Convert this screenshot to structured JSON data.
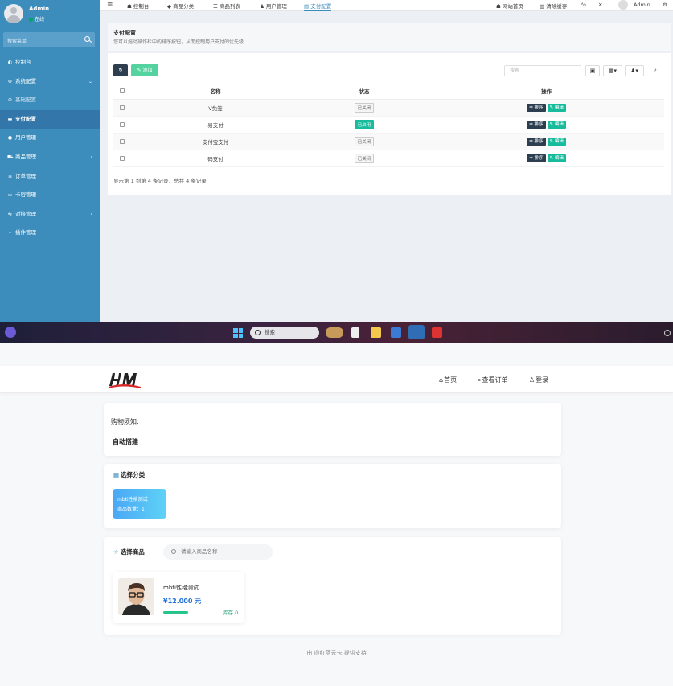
{
  "admin": {
    "user": {
      "name": "Admin",
      "status": "在线"
    },
    "sidebar": {
      "search_placeholder": "搜索菜单",
      "items": [
        {
          "label": "控制台",
          "icon": "dashboard-icon"
        },
        {
          "label": "系统配置",
          "icon": "gear-icon",
          "arrow": "⌄"
        },
        {
          "label": "基础配置",
          "icon": "gear-icon"
        },
        {
          "label": "支付配置",
          "icon": "card-icon",
          "active": true
        },
        {
          "label": "用户管理",
          "icon": "user-icon"
        },
        {
          "label": "商品管理",
          "icon": "cart-icon",
          "arrow": "‹"
        },
        {
          "label": "订单管理",
          "icon": "list-icon"
        },
        {
          "label": "卡密管理",
          "icon": "card-icon"
        },
        {
          "label": "对接管理",
          "icon": "link-icon",
          "arrow": "‹"
        },
        {
          "label": "插件管理",
          "icon": "plugin-icon"
        }
      ]
    },
    "topnav": {
      "tabs": [
        "控制台",
        "商品分类",
        "商品列表",
        "用户管理",
        "支付配置"
      ],
      "right": [
        "网站首页",
        "清除缓存"
      ],
      "user": "Admin"
    },
    "header": {
      "title": "支付配置",
      "desc": "您可以拖动操作栏中的排序按钮，从而控制用户支付的优先级"
    },
    "toolbar": {
      "add_label": "添加",
      "search_placeholder": "搜索"
    },
    "table": {
      "columns": [
        "名称",
        "状态",
        "操作"
      ],
      "rows": [
        {
          "name": "V免签",
          "status": "已关闭",
          "on": false,
          "op1": "排序",
          "op2": "编辑"
        },
        {
          "name": "易支付",
          "status": "已启用",
          "on": true,
          "op1": "排序",
          "op2": "编辑"
        },
        {
          "name": "支付宝支付",
          "status": "已关闭",
          "on": false,
          "op1": "排序",
          "op2": "编辑"
        },
        {
          "name": "码支付",
          "status": "已关闭",
          "on": false,
          "op1": "排序",
          "op2": "编辑"
        }
      ]
    },
    "pager": "显示第 1 到第 4 条记录，总共 4 条记录"
  },
  "taskbar": {
    "search": "搜索"
  },
  "shop": {
    "nav": [
      "首页",
      "查看订单",
      "登录"
    ],
    "notice": {
      "title": "购物须知:",
      "content": "自动搭建"
    },
    "category": {
      "title": "选择分类",
      "items": [
        {
          "name": "mbti性格测试",
          "count": "商品数量：1"
        }
      ]
    },
    "products": {
      "title": "选择商品",
      "search_placeholder": "请输入商品名称",
      "items": [
        {
          "name": "mbti性格测试",
          "price": "¥12.000 元",
          "stock": "库存 0"
        }
      ]
    },
    "footer": "由 @红蓝云卡 提供支持"
  },
  "colors": {
    "sidebar": "#3c8dbc",
    "accent_green": "#18bc9c",
    "price_blue": "#1e6fd9"
  }
}
